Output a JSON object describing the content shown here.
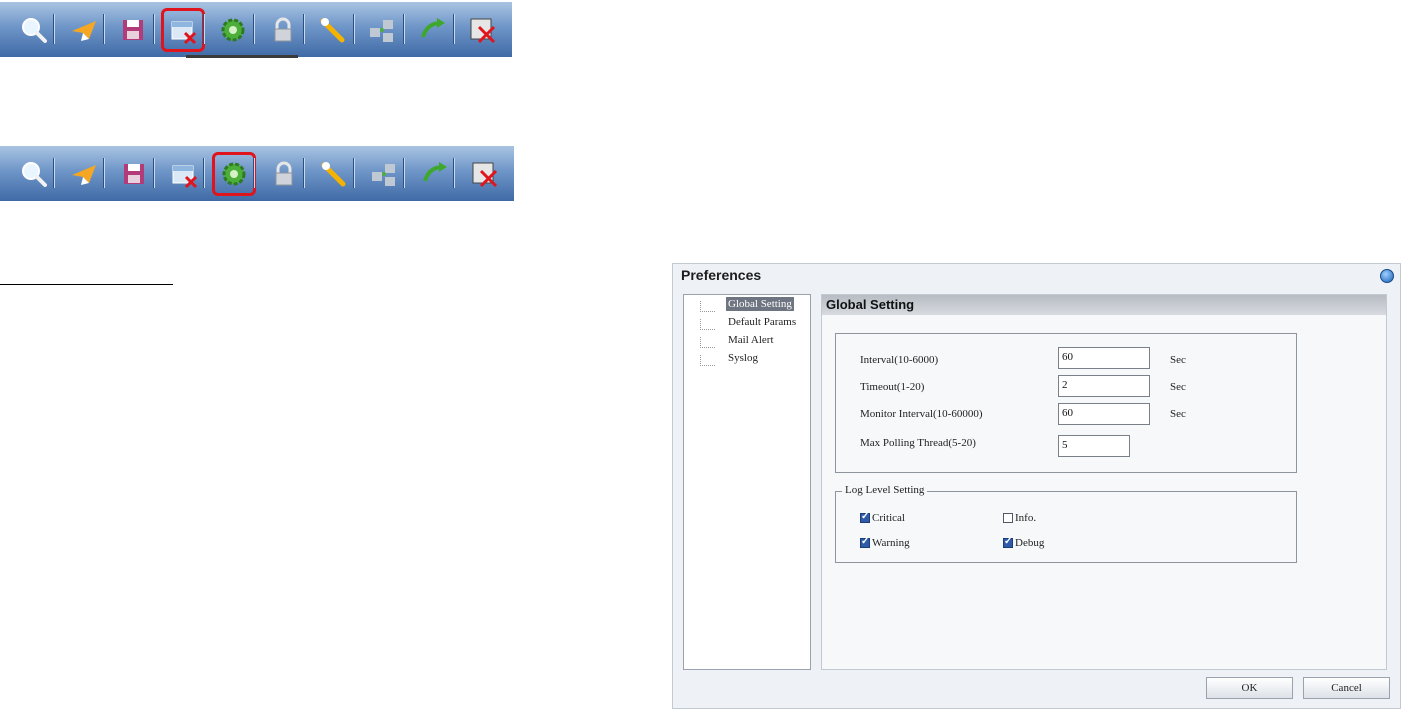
{
  "toolbar_icons": [
    "search-icon",
    "plane-icon",
    "save-icon",
    "delete-device-icon",
    "gear-icon",
    "lock-icon",
    "wrench-icon",
    "network-icon",
    "undo-icon",
    "exit-icon"
  ],
  "colors": {
    "highlight": "#e0141c",
    "toolbar_dark": "#3f6aa6",
    "toolbar_light": "#a9c4e2",
    "selection": "#6e7480"
  },
  "dialog": {
    "title": "Preferences",
    "tree": [
      "Global Setting",
      "Default Params",
      "Mail Alert",
      "Syslog"
    ],
    "panel_title": "Global Setting",
    "fields": [
      {
        "label": "Interval(10-6000)",
        "value": "60",
        "unit": "Sec"
      },
      {
        "label": "Timeout(1-20)",
        "value": "2",
        "unit": "Sec"
      },
      {
        "label": "Monitor Interval(10-60000)",
        "value": "60",
        "unit": "Sec"
      },
      {
        "label": "Max Polling Thread(5-20)",
        "value": "5"
      }
    ],
    "log_level": {
      "legend": "Log Level Setting",
      "options": [
        {
          "label": "Critical",
          "checked": true
        },
        {
          "label": "Info.",
          "checked": false
        },
        {
          "label": "Warning",
          "checked": true
        },
        {
          "label": "Debug",
          "checked": true
        }
      ]
    },
    "ok_label": "OK",
    "cancel_label": "Cancel"
  }
}
